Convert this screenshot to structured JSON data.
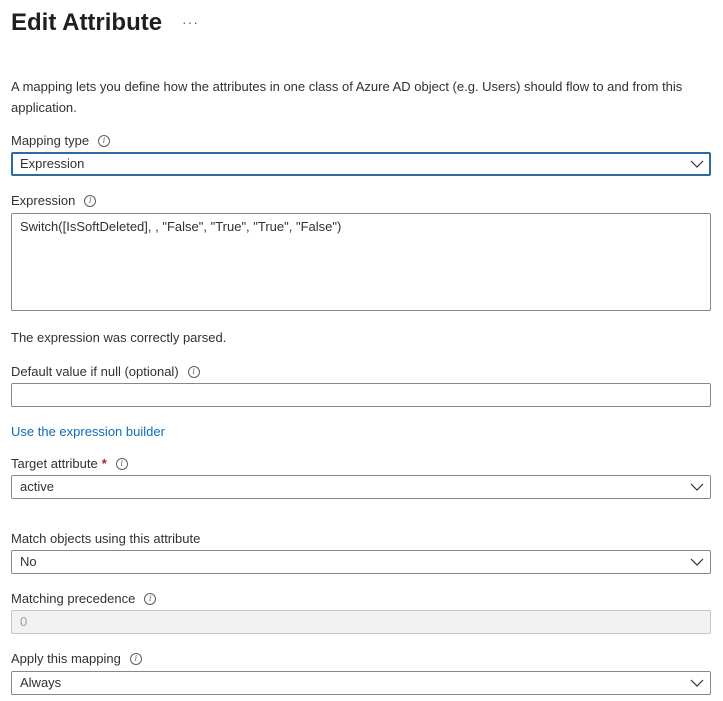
{
  "header": {
    "title": "Edit Attribute",
    "more_label": "···"
  },
  "description": "A mapping lets you define how the attributes in one class of Azure AD object (e.g. Users) should flow to and from this application.",
  "mapping_type": {
    "label": "Mapping type",
    "value": "Expression"
  },
  "expression": {
    "label": "Expression",
    "value": "Switch([IsSoftDeleted], , \"False\", \"True\", \"True\", \"False\")",
    "status": "The expression was correctly parsed."
  },
  "default_value": {
    "label": "Default value if null (optional)",
    "value": ""
  },
  "expression_builder_link": "Use the expression builder",
  "target_attribute": {
    "label": "Target attribute",
    "required_mark": "*",
    "value": "active"
  },
  "match_objects": {
    "label": "Match objects using this attribute",
    "value": "No"
  },
  "matching_precedence": {
    "label": "Matching precedence",
    "value": "0"
  },
  "apply_mapping": {
    "label": "Apply this mapping",
    "value": "Always"
  },
  "icons": {
    "info": "info-icon",
    "chevron": "chevron-down-icon",
    "more": "more-icon"
  },
  "colors": {
    "focus_border": "#2a6ba1",
    "link": "#0f6cbd",
    "required": "#a4262c",
    "disabled_bg": "#f3f2f1"
  }
}
